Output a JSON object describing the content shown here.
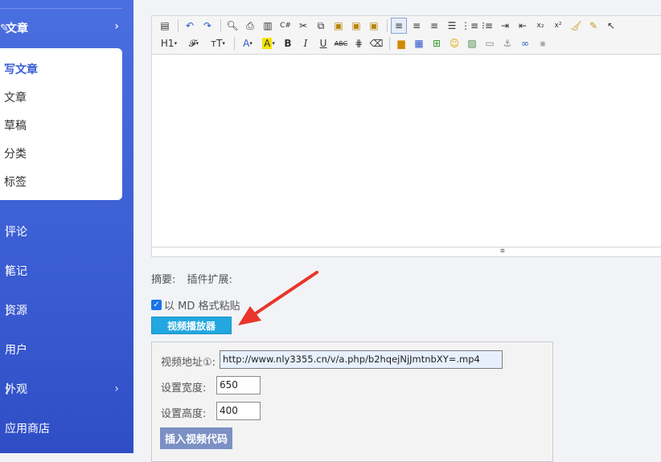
{
  "sidebar": {
    "section_title": "文章",
    "submenu": [
      {
        "label": "写文章",
        "active": true
      },
      {
        "label": "文章",
        "active": false
      },
      {
        "label": "草稿",
        "active": false
      },
      {
        "label": "分类",
        "active": false
      },
      {
        "label": "标签",
        "active": false
      }
    ],
    "items": [
      {
        "label": "评论",
        "has_chevron": false
      },
      {
        "label": "笔记",
        "has_chevron": false
      },
      {
        "label": "资源",
        "has_chevron": false
      },
      {
        "label": "用户",
        "has_chevron": false
      },
      {
        "label": "外观",
        "has_chevron": true
      },
      {
        "label": "应用商店",
        "has_chevron": false
      }
    ],
    "colors": {
      "bg": "#3c5ed4",
      "active_text": "#3c5ed4"
    }
  },
  "editor": {
    "toolbar_row1": [
      "source-icon",
      "undo-icon",
      "redo-icon",
      "preview-icon",
      "print-icon",
      "template-icon",
      "code-icon",
      "cut-icon",
      "copy-icon",
      "paste-icon",
      "paste-text-icon",
      "paste-word-icon",
      "align-left-icon",
      "align-center-icon",
      "align-right-icon",
      "align-justify-icon",
      "ordered-list-icon",
      "unordered-list-icon",
      "indent-icon",
      "outdent-icon",
      "subscript-icon",
      "superscript-icon",
      "clear-format-icon",
      "select-all-icon",
      "pointer-icon"
    ],
    "toolbar_row2": {
      "heading": "H1",
      "font_family": "𝓕",
      "font_size": "ᴛT",
      "font_color": "A",
      "highlight": "A",
      "bold": "B",
      "italic": "I",
      "underline": "U",
      "strike": "ABC"
    }
  },
  "summary": {
    "summary_label": "摘要:",
    "plugin_label": "插件扩展:"
  },
  "md_paste": {
    "label": "以 MD 格式粘贴",
    "checked": true
  },
  "video_player_button": "视频播放器",
  "video_panel": {
    "url_label": "视频地址①:",
    "url_value": "http://www.nly3355.cn/v/a.php/b2hqejNjJmtnbXY=.mp4",
    "width_label": "设置宽度:",
    "width_value": "650",
    "height_label": "设置高度:",
    "height_value": "400",
    "insert_button": "插入视频代码"
  },
  "annotation": {
    "arrow_color": "#e8352a"
  }
}
